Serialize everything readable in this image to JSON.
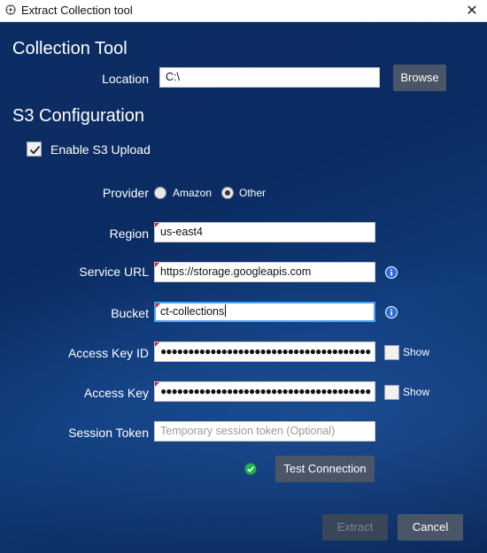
{
  "window": {
    "title": "Extract Collection tool",
    "close_glyph": "✕"
  },
  "collection": {
    "heading": "Collection Tool",
    "location_label": "Location",
    "location_value": "C:\\",
    "browse_label": "Browse"
  },
  "s3": {
    "heading": "S3 Configuration",
    "enable_label": "Enable S3 Upload",
    "enable_checked": true,
    "provider_label": "Provider",
    "provider_options": [
      "Amazon",
      "Other"
    ],
    "provider_selected": "Other",
    "region_label": "Region",
    "region_value": "us-east4",
    "service_url_label": "Service URL",
    "service_url_value": "https://storage.googleapis.com",
    "bucket_label": "Bucket",
    "bucket_value": "ct-collections",
    "access_key_id_label": "Access Key ID",
    "access_key_id_mask": "●●●●●●●●●●●●●●●●●●●●●●●●●●●●●●●●●●●●●●",
    "access_key_label": "Access Key",
    "access_key_mask": "●●●●●●●●●●●●●●●●●●●●●●●●●●●●●●●●●●●●●●",
    "show_label": "Show",
    "session_token_label": "Session Token",
    "session_token_placeholder": "Temporary session token (Optional)",
    "test_connection_label": "Test Connection",
    "connection_status": "success"
  },
  "footer": {
    "extract_label": "Extract",
    "cancel_label": "Cancel"
  },
  "colors": {
    "accent": "#4aa0ff",
    "info": "#2b6fd6",
    "success": "#22b24c",
    "required": "#e0202a"
  },
  "icons": [
    "app-icon",
    "close-icon",
    "checkmark-icon",
    "info-icon",
    "success-check-icon"
  ]
}
